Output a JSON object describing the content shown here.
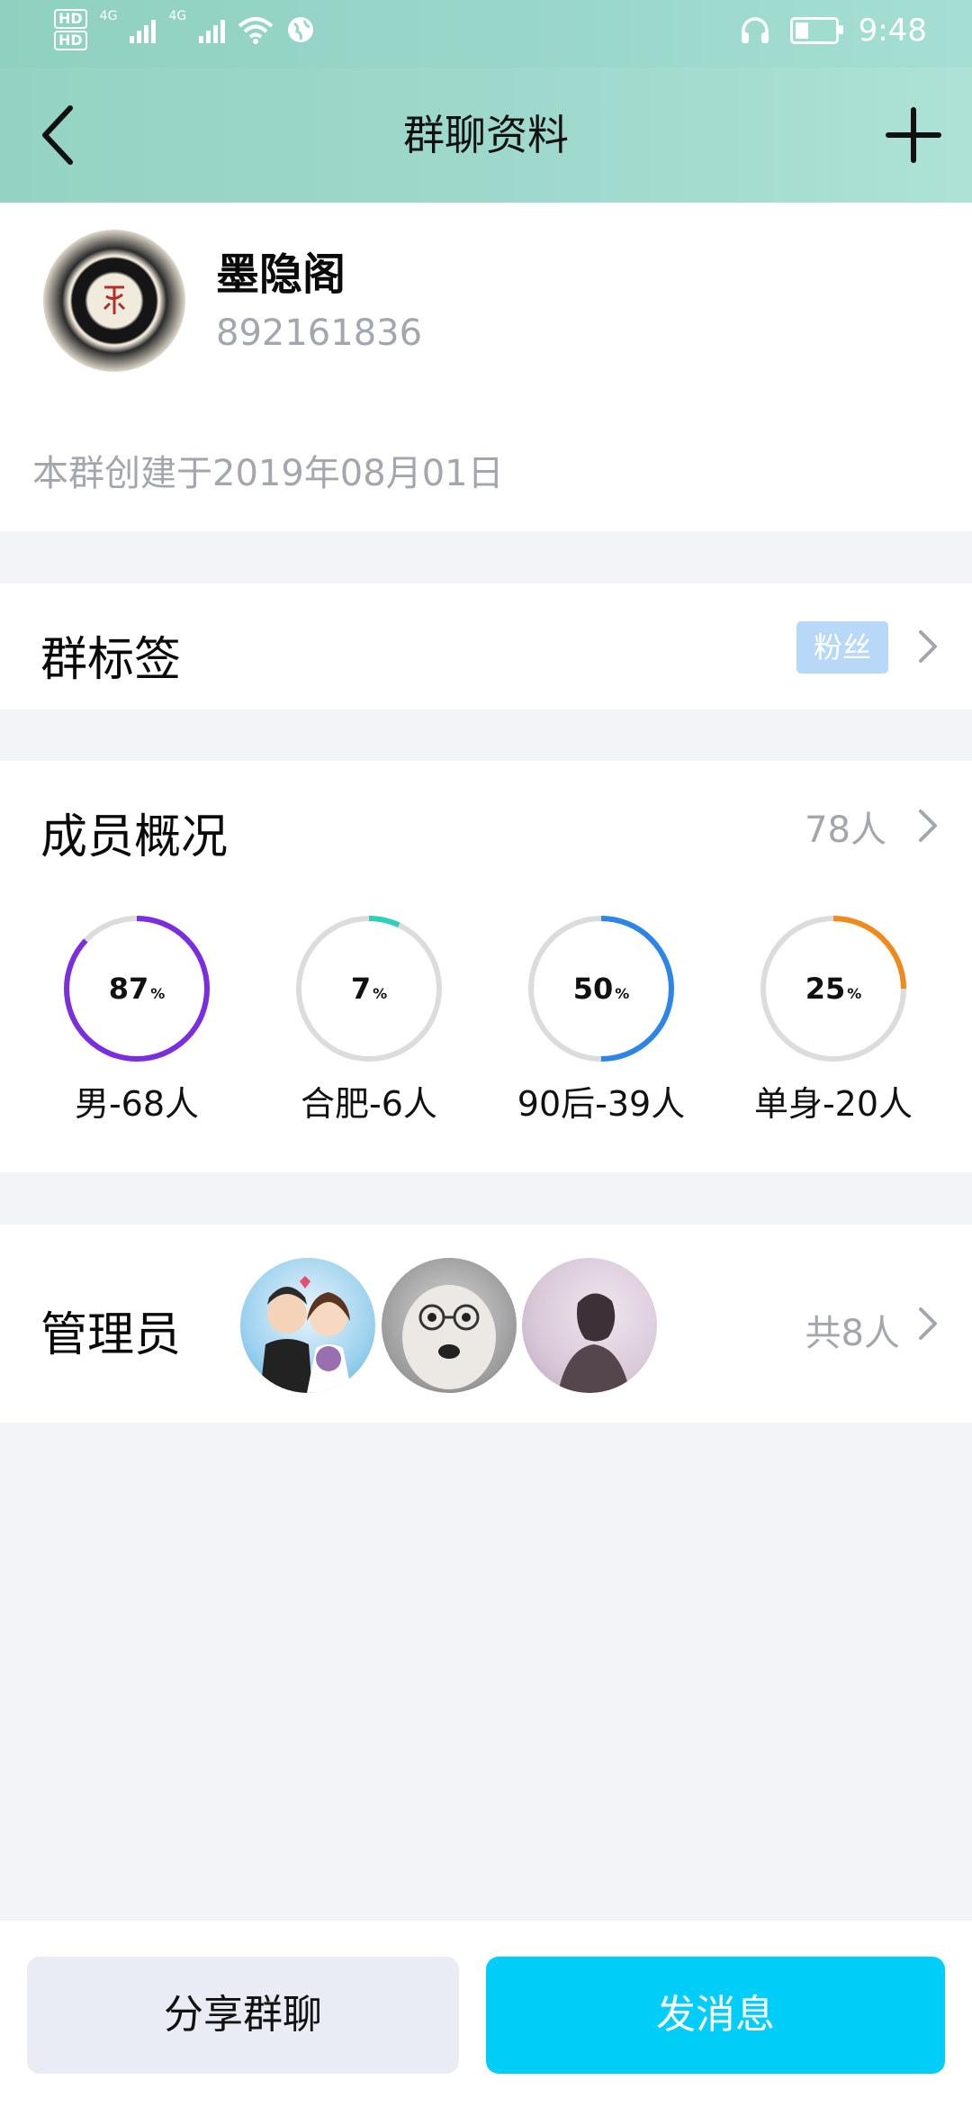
{
  "status_bar": {
    "time": "9:48",
    "hd_top": "HD",
    "hd_bottom": "HD",
    "network_1": "4G",
    "network_2": "4G",
    "icons": [
      "hd-icon",
      "signal-icon",
      "signal-icon",
      "wifi-icon",
      "globe-icon",
      "headphones-icon",
      "battery-icon"
    ]
  },
  "nav": {
    "title": "群聊资料",
    "back_icon": "chevron-left-icon",
    "add_icon": "plus-icon"
  },
  "group": {
    "name": "墨隐阁",
    "id": "892161836",
    "created": "本群创建于2019年08月01日"
  },
  "tag_row": {
    "label": "群标签",
    "badge": "粉丝"
  },
  "members": {
    "label": "成员概况",
    "count": "78人",
    "stats": [
      {
        "percent": 87,
        "value": "87",
        "unit": "%",
        "label": "男-68人",
        "color": "#7b2ee0"
      },
      {
        "percent": 7,
        "value": "7",
        "unit": "%",
        "label": "合肥-6人",
        "color": "#2ed0b8"
      },
      {
        "percent": 50,
        "value": "50",
        "unit": "%",
        "label": "90后-39人",
        "color": "#2b86e8"
      },
      {
        "percent": 25,
        "value": "25",
        "unit": "%",
        "label": "单身-20人",
        "color": "#f08a1c"
      }
    ]
  },
  "admins": {
    "label": "管理员",
    "count": "共8人"
  },
  "bottom": {
    "share_label": "分享群聊",
    "send_label": "发消息"
  },
  "colors": {
    "accent": "#00cdf8",
    "header": "#9ad7cb",
    "muted_text": "#a3a6ad",
    "background": "#f3f4f8"
  }
}
